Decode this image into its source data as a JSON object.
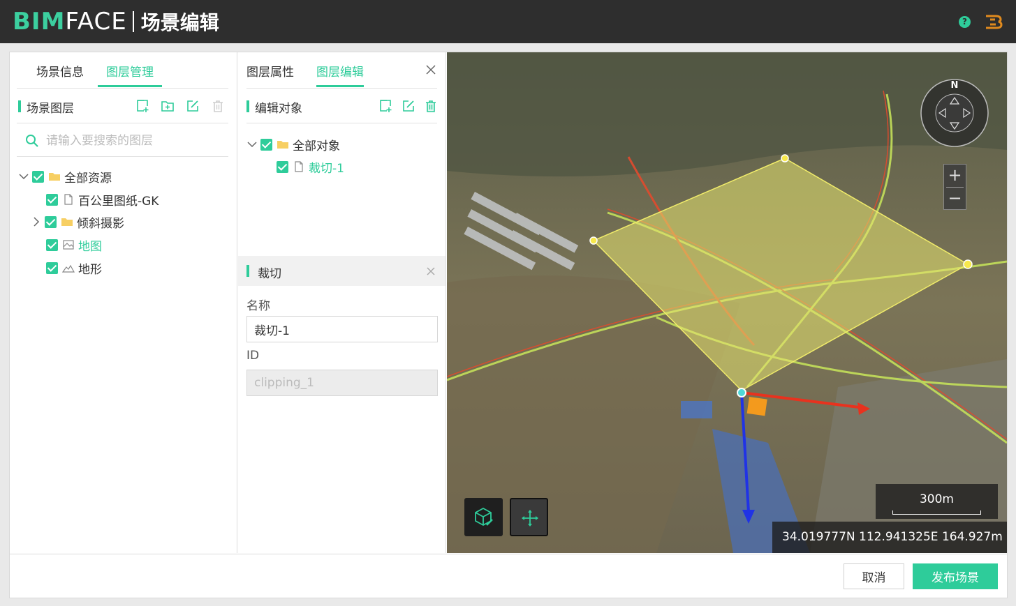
{
  "header": {
    "logo_bim": "BIM",
    "logo_face": "FACE",
    "app_title": "场景编辑",
    "help_glyph": "?",
    "user_glyph": "B",
    "colors": {
      "bar": "#2e2e2e",
      "accent": "#2ecc9a",
      "user": "#e08a1e"
    }
  },
  "left_panel": {
    "tabs": [
      {
        "label": "场景信息",
        "active": false
      },
      {
        "label": "图层管理",
        "active": true
      }
    ],
    "section_title": "场景图层",
    "tools": [
      "add-layer-icon",
      "add-folder-icon",
      "edit-icon",
      "delete-icon"
    ],
    "search": {
      "placeholder": "请输入要搜索的图层",
      "value": ""
    },
    "tree": [
      {
        "label": "全部资源",
        "level": 0,
        "expanded": true,
        "checked": true,
        "icon": "folder-icon",
        "active": false
      },
      {
        "label": "百公里图纸-GK",
        "level": 1,
        "checked": true,
        "icon": "file-icon",
        "active": false
      },
      {
        "label": "倾斜摄影",
        "level": 1,
        "expanded": false,
        "checked": true,
        "icon": "folder-icon",
        "active": false
      },
      {
        "label": "地图",
        "level": 1,
        "checked": true,
        "icon": "map-icon",
        "active": true
      },
      {
        "label": "地形",
        "level": 1,
        "checked": true,
        "icon": "terrain-icon",
        "active": false
      }
    ]
  },
  "mid_panel": {
    "tabs": [
      {
        "label": "图层属性",
        "active": false
      },
      {
        "label": "图层编辑",
        "active": true
      }
    ],
    "section_title": "编辑对象",
    "tools": [
      "add-object-icon",
      "edit-icon",
      "delete-icon"
    ],
    "tree": [
      {
        "label": "全部对象",
        "level": 0,
        "expanded": true,
        "checked": true,
        "icon": "folder-icon",
        "active": false
      },
      {
        "label": "裁切-1",
        "level": 1,
        "checked": true,
        "icon": "file-icon",
        "active": true
      }
    ],
    "clip_section": {
      "title": "裁切",
      "name_label": "名称",
      "name_value": "裁切-1",
      "id_label": "ID",
      "id_value": "clipping_1"
    }
  },
  "viewport": {
    "compass_north": "N",
    "zoom_in": "+",
    "zoom_out": "−",
    "scale_label": "300m",
    "coordinates": "34.019777N  112.941325E  164.927m",
    "tools": [
      {
        "name": "clip-box-tool",
        "active": false
      },
      {
        "name": "move-tool",
        "active": true
      }
    ],
    "axis_colors": {
      "x": "#e8321e",
      "y": "#2033e6"
    }
  },
  "footer": {
    "cancel_label": "取消",
    "publish_label": "发布场景"
  }
}
